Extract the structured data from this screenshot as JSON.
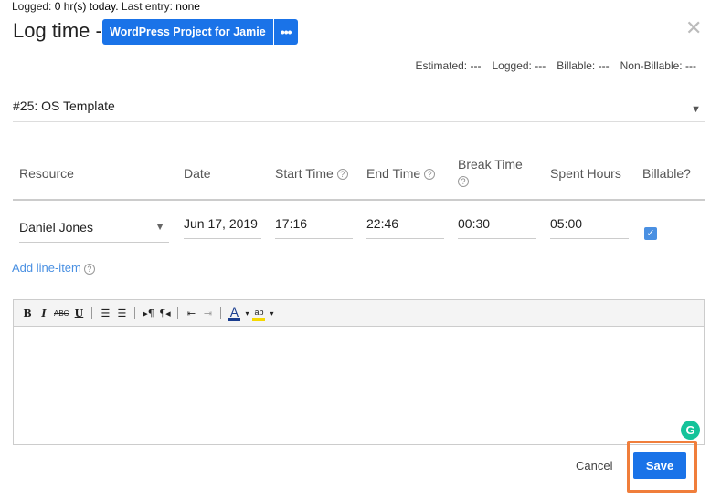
{
  "logged": {
    "prefix": "Logged:",
    "hours": "0 hr(s) today.",
    "last_prefix": "Last entry:",
    "last": "none"
  },
  "header": {
    "title": "Log time -",
    "project": "WordPress Project for Jamie",
    "more": "•••",
    "close": "✕"
  },
  "stats": [
    {
      "label": "Estimated:",
      "value": "---"
    },
    {
      "label": "Logged:",
      "value": "---"
    },
    {
      "label": "Billable:",
      "value": "---"
    },
    {
      "label": "Non-Billable:",
      "value": "---"
    }
  ],
  "task": {
    "value": "#25: OS Template",
    "arrow": "▼"
  },
  "columns": {
    "resource": "Resource",
    "date": "Date",
    "start": "Start Time",
    "end": "End Time",
    "break": "Break Time",
    "spent": "Spent Hours",
    "billable": "Billable?",
    "help": "?"
  },
  "row": {
    "resource": "Daniel Jones",
    "resource_arrow": "▼",
    "date": "Jun 17, 2019",
    "start": "17:16",
    "end": "22:46",
    "break": "00:30",
    "spent": "05:00",
    "billable_check": "✓"
  },
  "add_line": "Add line-item",
  "toolbar": {
    "bold": "B",
    "italic": "I",
    "strike": "ABC",
    "underline": "U",
    "ordered": "☰",
    "bullets": "☰",
    "ltr": "▸¶",
    "rtl": "¶◂",
    "outdent": "⇤",
    "indent": "⇥",
    "text_color": "A",
    "highlight": "ab",
    "caret": "▾"
  },
  "grammarly": "G",
  "actions": {
    "cancel": "Cancel",
    "save": "Save"
  }
}
